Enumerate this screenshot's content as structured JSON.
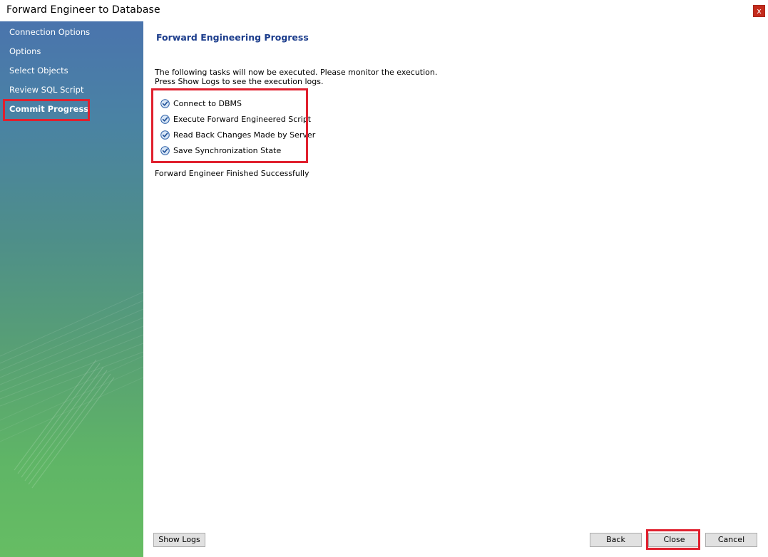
{
  "window": {
    "title": "Forward Engineer to Database",
    "close_label": "x"
  },
  "sidebar": {
    "items": [
      {
        "label": "Connection Options",
        "active": false
      },
      {
        "label": "Options",
        "active": false
      },
      {
        "label": "Select Objects",
        "active": false
      },
      {
        "label": "Review SQL Script",
        "active": false
      },
      {
        "label": "Commit Progress",
        "active": true
      }
    ]
  },
  "main": {
    "heading": "Forward Engineering Progress",
    "description_lines": [
      "The following tasks will now be executed. Please monitor the execution.",
      "Press Show Logs to see the execution logs."
    ],
    "tasks": [
      {
        "label": "Connect to DBMS",
        "icon": "check-circle-icon",
        "done": true
      },
      {
        "label": "Execute Forward Engineered Script",
        "icon": "check-circle-icon",
        "done": true
      },
      {
        "label": "Read Back Changes Made by Server",
        "icon": "check-circle-icon",
        "done": true
      },
      {
        "label": "Save Synchronization State",
        "icon": "check-circle-icon",
        "done": true
      }
    ],
    "status": "Forward Engineer Finished Successfully"
  },
  "buttons": {
    "show_logs": "Show Logs",
    "back": "Back",
    "close": "Close",
    "cancel": "Cancel"
  },
  "colors": {
    "accent": "#1c3d8c",
    "highlight": "#e0202e",
    "check": "#2b5fa8"
  }
}
